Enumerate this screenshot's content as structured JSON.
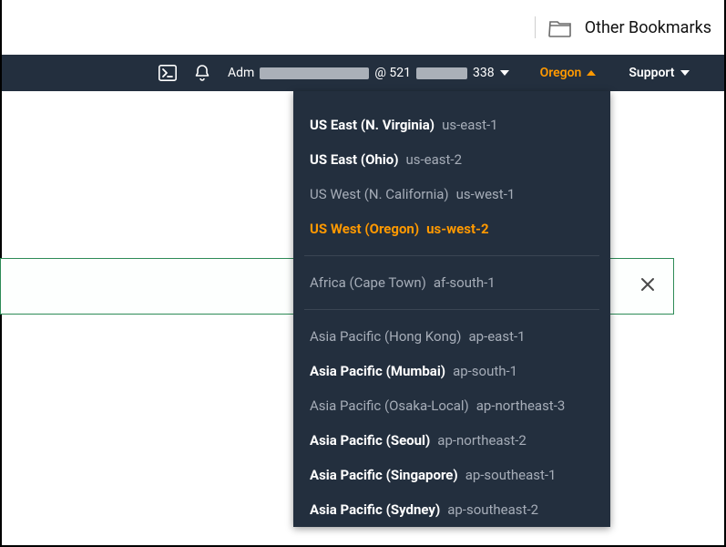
{
  "bookmarks": {
    "label": "Other Bookmarks"
  },
  "header": {
    "account_prefix": "Adm",
    "account_mid": " @ 521",
    "account_suffix": "338",
    "region_label": "Oregon",
    "support_label": "Support"
  },
  "regions": {
    "group1": [
      {
        "name": "US East (N. Virginia)",
        "code": "us-east-1",
        "enabled": true,
        "selected": false
      },
      {
        "name": "US East (Ohio)",
        "code": "us-east-2",
        "enabled": true,
        "selected": false
      },
      {
        "name": "US West (N. California)",
        "code": "us-west-1",
        "enabled": false,
        "selected": false
      },
      {
        "name": "US West (Oregon)",
        "code": "us-west-2",
        "enabled": true,
        "selected": true
      }
    ],
    "group2": [
      {
        "name": "Africa (Cape Town)",
        "code": "af-south-1",
        "enabled": false,
        "selected": false
      }
    ],
    "group3": [
      {
        "name": "Asia Pacific (Hong Kong)",
        "code": "ap-east-1",
        "enabled": false,
        "selected": false
      },
      {
        "name": "Asia Pacific (Mumbai)",
        "code": "ap-south-1",
        "enabled": true,
        "selected": false
      },
      {
        "name": "Asia Pacific (Osaka-Local)",
        "code": "ap-northeast-3",
        "enabled": false,
        "selected": false
      },
      {
        "name": "Asia Pacific (Seoul)",
        "code": "ap-northeast-2",
        "enabled": true,
        "selected": false
      },
      {
        "name": "Asia Pacific (Singapore)",
        "code": "ap-southeast-1",
        "enabled": true,
        "selected": false
      },
      {
        "name": "Asia Pacific (Sydney)",
        "code": "ap-southeast-2",
        "enabled": true,
        "selected": false
      }
    ]
  },
  "colors": {
    "accent": "#ff9900",
    "headerBg": "#232f3e"
  }
}
